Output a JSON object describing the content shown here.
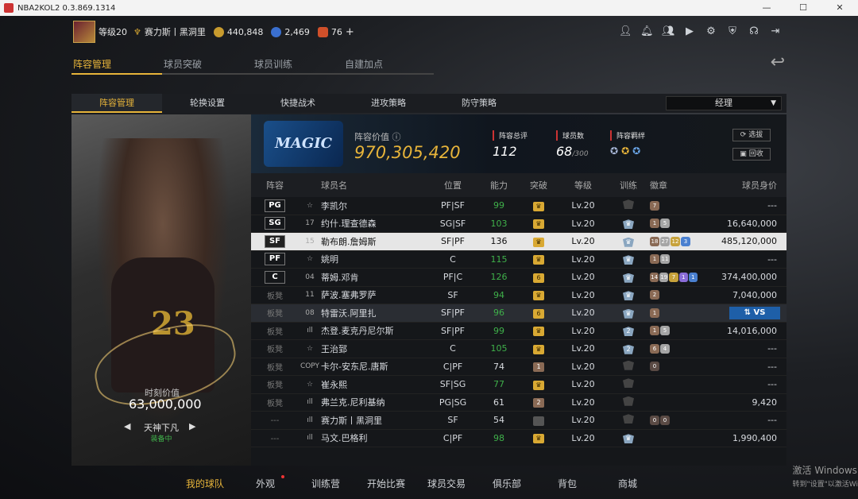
{
  "window": {
    "title": "NBA2KOL2 0.3.869.1314"
  },
  "topbar": {
    "level": "等级20",
    "rank_icon": "rank-badge-icon",
    "player_name": "赛力斯丨黑洞里",
    "gold": "440,848",
    "points": "2,469",
    "tickets": "76",
    "plus": "+"
  },
  "top_icons": [
    "person-icon",
    "bell-icon",
    "friends-icon",
    "video-icon",
    "gear-icon",
    "shield-icon",
    "headset-icon",
    "exit-icon"
  ],
  "main_tabs": [
    "阵容管理",
    "球员突破",
    "球员训练",
    "自建加点"
  ],
  "sub_tabs": [
    "阵容管理",
    "轮换设置",
    "快捷战术",
    "进攻策略",
    "防守策略"
  ],
  "manager_dropdown": "经理",
  "player_card": {
    "value_label": "时刻价值",
    "value": "63,000,000",
    "skin_name": "天神下凡",
    "equip_status": "装备中",
    "jersey_number": "23"
  },
  "team": {
    "logo_text": "MAGIC",
    "lineup_value_label": "阵容价值",
    "lineup_value": "970,305,420",
    "total_rating_label": "阵容总评",
    "total_rating": "112",
    "player_count_label": "球员数",
    "player_count": "68",
    "player_count_max": "/300",
    "bond_label": "阵容羁绊",
    "select_btn": "选拔",
    "recycle_btn": "回收"
  },
  "table_headers": [
    "阵容",
    "球员名",
    "位置",
    "能力",
    "突破",
    "等级",
    "训练",
    "徽章",
    "球员身价"
  ],
  "rows": [
    {
      "slot": "PG",
      "num": "☆",
      "name": "李凯尔",
      "pos": "PF|SF",
      "ability": "99",
      "green": true,
      "brk": "crown",
      "lv": "Lv.20",
      "trn": "grey",
      "badges": [
        [
          "h-b",
          "7"
        ]
      ],
      "value": "---"
    },
    {
      "slot": "SG",
      "num": "17",
      "name": "约什.理查德森",
      "pos": "SG|SF",
      "ability": "103",
      "green": true,
      "brk": "crown",
      "lv": "Lv.20",
      "trn": "shield",
      "badges": [
        [
          "h-b",
          "1"
        ],
        [
          "h-s",
          "5"
        ]
      ],
      "value": "16,640,000"
    },
    {
      "slot": "SF",
      "num": "15",
      "name": "勒布朗.詹姆斯",
      "pos": "SF|PF",
      "ability": "136",
      "green": false,
      "brk": "crown",
      "lv": "Lv.20",
      "trn": "shield",
      "badges": [
        [
          "h-b",
          "18"
        ],
        [
          "h-s",
          "27"
        ],
        [
          "h-g",
          "12"
        ],
        [
          "h-bl",
          "3"
        ]
      ],
      "value": "485,120,000",
      "sel": true
    },
    {
      "slot": "PF",
      "num": "☆",
      "name": "姚明",
      "pos": "C",
      "ability": "115",
      "green": true,
      "brk": "crown",
      "lv": "Lv.20",
      "trn": "shield",
      "badges": [
        [
          "h-b",
          "1"
        ],
        [
          "h-s",
          "11"
        ]
      ],
      "value": "---"
    },
    {
      "slot": "C",
      "num": "04",
      "name": "蒂姆.邓肯",
      "pos": "PF|C",
      "ability": "126",
      "green": true,
      "brk": "6",
      "lv": "Lv.20",
      "trn": "shield",
      "badges": [
        [
          "h-b",
          "14"
        ],
        [
          "h-s",
          "19"
        ],
        [
          "h-g",
          "7"
        ],
        [
          "h-p",
          "1"
        ],
        [
          "h-bl",
          "1"
        ]
      ],
      "value": "374,400,000"
    },
    {
      "slot": "板凳",
      "num": "11",
      "name": "萨波.塞弗罗萨",
      "pos": "SF",
      "ability": "94",
      "green": true,
      "brk": "crown",
      "lv": "Lv.20",
      "trn": "shield",
      "badges": [
        [
          "h-b",
          "2"
        ]
      ],
      "value": "7,040,000"
    },
    {
      "slot": "板凳",
      "num": "08",
      "name": "特雷沃.阿里扎",
      "pos": "SF|PF",
      "ability": "96",
      "green": true,
      "brk": "6",
      "lv": "Lv.20",
      "trn": "shield",
      "badges": [
        [
          "h-b",
          "1"
        ]
      ],
      "value": "",
      "hl": true,
      "vs": "VS"
    },
    {
      "slot": "板凳",
      "num": "ıll",
      "name": "杰登.麦克丹尼尔斯",
      "pos": "SF|PF",
      "ability": "99",
      "green": true,
      "brk": "crown",
      "lv": "Lv.20",
      "trn": "2",
      "badges": [
        [
          "h-b",
          "1"
        ],
        [
          "h-s",
          "5"
        ]
      ],
      "value": "14,016,000"
    },
    {
      "slot": "板凳",
      "num": "☆",
      "name": "王治郅",
      "pos": "C",
      "ability": "105",
      "green": true,
      "brk": "crown",
      "lv": "Lv.20",
      "trn": "2",
      "badges": [
        [
          "h-b",
          "6"
        ],
        [
          "h-s",
          "4"
        ]
      ],
      "value": "---"
    },
    {
      "slot": "板凳",
      "num": "COPY",
      "name": "卡尔-安东尼.唐斯",
      "pos": "C|PF",
      "ability": "74",
      "green": false,
      "brk": "1b",
      "lv": "Lv.20",
      "trn": "grey",
      "badges": [
        [
          "h-d",
          "0"
        ]
      ],
      "value": "---"
    },
    {
      "slot": "板凳",
      "num": "☆",
      "name": "崔永熙",
      "pos": "SF|SG",
      "ability": "77",
      "green": true,
      "brk": "crown",
      "lv": "Lv.20",
      "trn": "grey",
      "badges": [],
      "value": "---"
    },
    {
      "slot": "板凳",
      "num": "ıll",
      "name": "弗兰克.尼利基纳",
      "pos": "PG|SG",
      "ability": "61",
      "green": false,
      "brk": "2b",
      "lv": "Lv.20",
      "trn": "grey",
      "badges": [],
      "value": "9,420"
    },
    {
      "slot": "---",
      "num": "ıll",
      "name": "赛力斯丨黑洞里",
      "pos": "SF",
      "ability": "54",
      "green": false,
      "brk": "g",
      "lv": "Lv.20",
      "trn": "grey",
      "badges": [
        [
          "h-d",
          "0"
        ],
        [
          "h-d",
          "0"
        ]
      ],
      "value": "---"
    },
    {
      "slot": "---",
      "num": "ıll",
      "name": "马文.巴格利",
      "pos": "C|PF",
      "ability": "98",
      "green": true,
      "brk": "crown",
      "lv": "Lv.20",
      "trn": "shield",
      "badges": [],
      "value": "1,990,400"
    }
  ],
  "bottom_nav": [
    "我的球队",
    "外观",
    "训练营",
    "开始比赛",
    "球员交易",
    "俱乐部",
    "背包",
    "商城"
  ],
  "activation": {
    "line1": "激活 Windows",
    "line2": "转到\"设置\"以激活Wi"
  }
}
